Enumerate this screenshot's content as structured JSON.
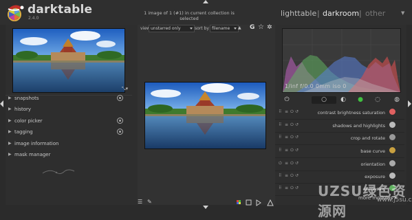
{
  "header": {
    "app_name": "darktable",
    "version": "2.4.0",
    "collection_info": "1 image of 1 (#1) in current collection is selected",
    "views": [
      "lighttable",
      "darkroom",
      "other"
    ],
    "separator": "|",
    "active_view": "darkroom"
  },
  "left_panel": {
    "modules": [
      {
        "label": "snapshots",
        "icon": "gear-icon"
      },
      {
        "label": "history",
        "icon": null
      },
      {
        "label": "color picker",
        "icon": "gear-icon"
      },
      {
        "label": "tagging",
        "icon": "gear-icon"
      },
      {
        "label": "image information",
        "icon": null
      },
      {
        "label": "mask manager",
        "icon": null
      }
    ]
  },
  "filmstrip_toolbar": {
    "view_label": "view",
    "view_value": "unstarred only",
    "sort_label": "sort by",
    "sort_value": "filename",
    "sort_direction": "▲"
  },
  "histogram": {
    "exif": "1/inf f/0.0 0mm iso 0"
  },
  "right_panel": {
    "group_icons": [
      "power-icon",
      "circle-icon",
      "half-circle-icon",
      "color-icon",
      "correct-icon",
      "effect-icon"
    ],
    "modules": [
      {
        "name": "contrast brightness saturation",
        "icon_color": "#e06060"
      },
      {
        "name": "shadows and highlights",
        "icon_color": "#bbbbbb"
      },
      {
        "name": "crop and rotate",
        "icon_color": "#999999"
      },
      {
        "name": "base curve",
        "icon_color": "#c8a040"
      },
      {
        "name": "orientation",
        "icon_color": "#aaaaaa"
      },
      {
        "name": "exposure",
        "icon_color": "#bbbbbb"
      },
      {
        "name": "demosaic",
        "icon_color": "#60b060"
      }
    ],
    "more_modules": "more modules ▾"
  },
  "watermark": {
    "text": "UZSU绿色资源网",
    "sub": "www.j5su.com"
  },
  "colors": {
    "background": "#2b2b2b",
    "panel": "#2e2e2e",
    "center": "#323232",
    "accent_red": "#c0302a"
  }
}
